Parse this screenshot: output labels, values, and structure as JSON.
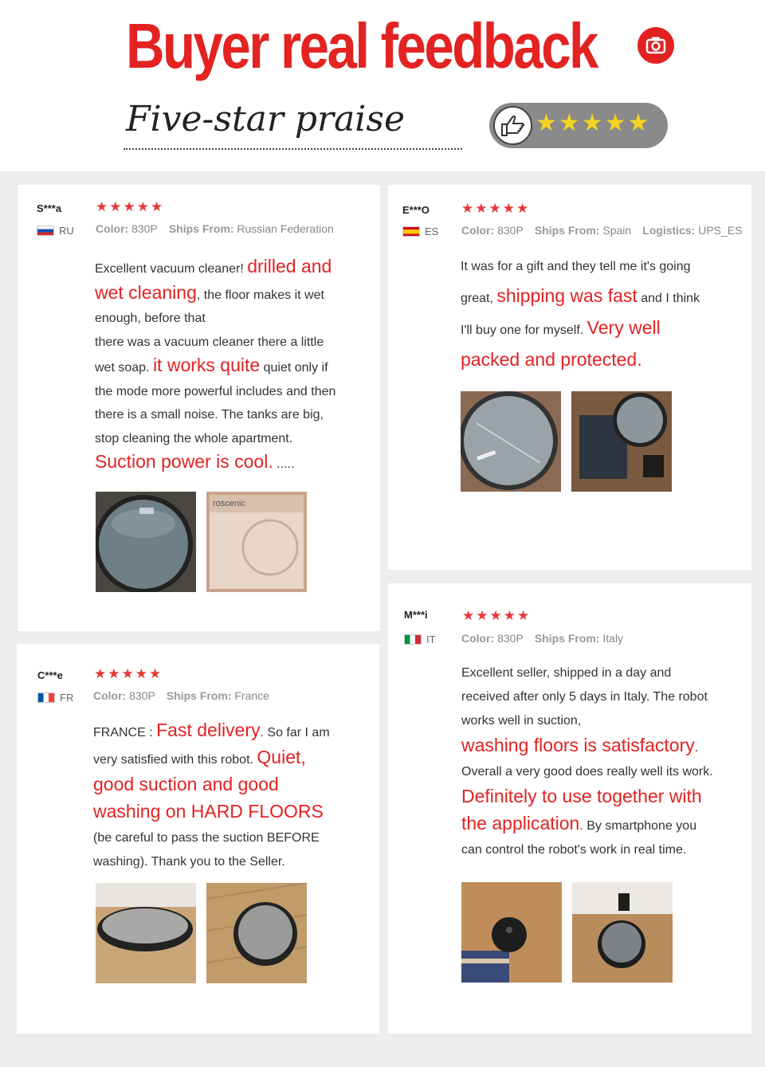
{
  "header": {
    "title": "Buyer real feedback",
    "subtitle": "Five-star praise",
    "pill_stars": "★★★★★"
  },
  "colors": {
    "accent": "#e32222",
    "star_red": "#e53935",
    "star_yellow": "#f5d31f",
    "background": "#eceded"
  },
  "icons": {
    "camera": "camera-icon",
    "thumb": "thumbs-up-icon"
  },
  "labels": {
    "color": "Color:",
    "ships_from": "Ships From:",
    "logistics": "Logistics:"
  },
  "reviews": [
    {
      "name": "S***a",
      "country": "RU",
      "stars": "★★★★★",
      "color": "830P",
      "ships_from": "Russian Federation",
      "lines": [
        [
          {
            "t": "Excellent vacuum cleaner! "
          },
          {
            "t": "drilled and",
            "hl": true
          }
        ],
        [
          {
            "t": "wet cleaning",
            "hl": true
          },
          {
            "t": ", the floor makes it wet"
          }
        ],
        [
          {
            "t": "enough, before that"
          }
        ],
        [
          {
            "t": "there was a vacuum cleaner there a little"
          }
        ],
        [
          {
            "t": "wet soap. "
          },
          {
            "t": "it works quite",
            "hl": true
          },
          {
            "t": " quiet only if"
          }
        ],
        [
          {
            "t": "the mode more powerful includes and then"
          }
        ],
        [
          {
            "t": "there is a small noise. The tanks are big,"
          }
        ],
        [
          {
            "t": "stop cleaning the whole apartment."
          }
        ],
        [
          {
            "t": "Suction power is cool.",
            "hl": true
          },
          {
            "t": " ....."
          }
        ]
      ]
    },
    {
      "name": "E***O",
      "country": "ES",
      "stars": "★★★★★",
      "color": "830P",
      "ships_from": "Spain",
      "logistics": "UPS_ES",
      "lines": [
        [
          {
            "t": "It was for a gift and they tell me it's going"
          }
        ],
        [
          {
            "t": "great, "
          },
          {
            "t": "shipping was fast",
            "hl": true
          },
          {
            "t": " and I think"
          }
        ],
        [
          {
            "t": "I'll buy one for myself. "
          },
          {
            "t": "Very well",
            "hl": true
          }
        ],
        [
          {
            "t": "packed and protected.",
            "hl": true
          }
        ]
      ]
    },
    {
      "name": "C***e",
      "country": "FR",
      "stars": "★★★★★",
      "color": "830P",
      "ships_from": "France",
      "lines": [
        [
          {
            "t": "FRANCE : "
          },
          {
            "t": "Fast delivery",
            "hl": true
          },
          {
            "t": ". So far I am"
          }
        ],
        [
          {
            "t": "very satisfied with this robot. "
          },
          {
            "t": "Quiet,",
            "hl": true
          }
        ],
        [
          {
            "t": "good suction and good",
            "hl": true
          }
        ],
        [
          {
            "t": "washing on HARD FLOORS",
            "hl": true
          }
        ],
        [
          {
            "t": "(be careful to pass the suction BEFORE"
          }
        ],
        [
          {
            "t": "washing). Thank you to the Seller."
          }
        ]
      ]
    },
    {
      "name": "M***i",
      "country": "IT",
      "stars": "★★★★★",
      "color": "830P",
      "ships_from": "Italy",
      "lines": [
        [
          {
            "t": "Excellent seller, shipped in a day and"
          }
        ],
        [
          {
            "t": "received after only 5 days in Italy. The robot"
          }
        ],
        [
          {
            "t": "works well in suction,"
          }
        ],
        [
          {
            "t": "washing floors is satisfactory",
            "hl": true
          },
          {
            "t": "."
          }
        ],
        [
          {
            "t": "Overall a very good does really well its work."
          }
        ],
        [
          {
            "t": "Definitely to use together with",
            "hl": true
          }
        ],
        [
          {
            "t": "the application",
            "hl": true
          },
          {
            "t": ". By smartphone you"
          }
        ],
        [
          {
            "t": "can control the robot's work in real time."
          }
        ]
      ]
    }
  ]
}
